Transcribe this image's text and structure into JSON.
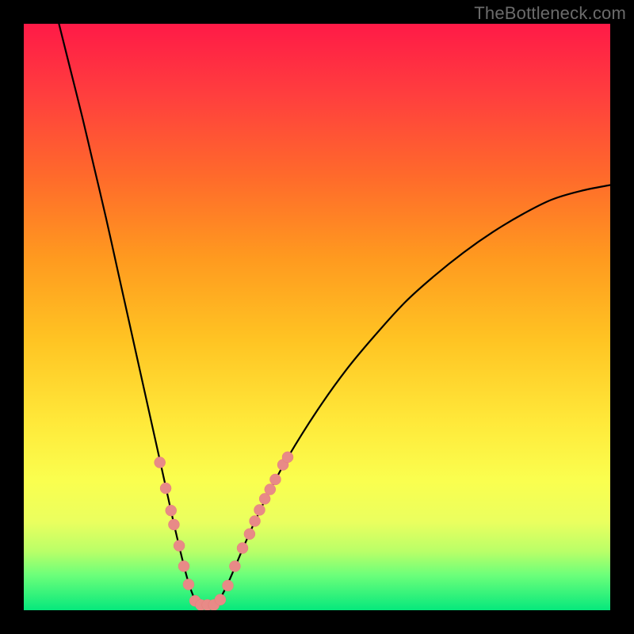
{
  "watermark": "TheBottleneck.com",
  "colors": {
    "frame": "#000000",
    "bead": "#e88a87",
    "curve": "#000000",
    "gradient_top": "#ff1a47",
    "gradient_bottom": "#06e87c"
  },
  "chart_data": {
    "type": "line",
    "title": "",
    "xlabel": "",
    "ylabel": "",
    "xlim": [
      0,
      100
    ],
    "ylim": [
      0,
      100
    ],
    "grid": false,
    "legend": false,
    "curve_left": {
      "description": "Steep descending branch entering from top-left, reaching valley floor near x≈29",
      "points": [
        {
          "x": 6.0,
          "y": 100.0
        },
        {
          "x": 8.0,
          "y": 92.0
        },
        {
          "x": 10.0,
          "y": 84.0
        },
        {
          "x": 12.0,
          "y": 75.5
        },
        {
          "x": 14.0,
          "y": 67.0
        },
        {
          "x": 16.0,
          "y": 58.0
        },
        {
          "x": 18.0,
          "y": 49.0
        },
        {
          "x": 20.0,
          "y": 40.0
        },
        {
          "x": 22.0,
          "y": 31.0
        },
        {
          "x": 24.0,
          "y": 22.0
        },
        {
          "x": 26.0,
          "y": 13.0
        },
        {
          "x": 28.0,
          "y": 5.0
        },
        {
          "x": 29.5,
          "y": 1.0
        }
      ]
    },
    "curve_right": {
      "description": "Ascending branch rising from valley, concave, exiting at right edge near y≈72",
      "points": [
        {
          "x": 33.0,
          "y": 1.0
        },
        {
          "x": 35.0,
          "y": 5.0
        },
        {
          "x": 38.0,
          "y": 12.0
        },
        {
          "x": 41.0,
          "y": 18.5
        },
        {
          "x": 45.0,
          "y": 26.0
        },
        {
          "x": 50.0,
          "y": 34.0
        },
        {
          "x": 55.0,
          "y": 41.0
        },
        {
          "x": 60.0,
          "y": 47.0
        },
        {
          "x": 65.0,
          "y": 52.5
        },
        {
          "x": 70.0,
          "y": 57.0
        },
        {
          "x": 75.0,
          "y": 61.0
        },
        {
          "x": 80.0,
          "y": 64.5
        },
        {
          "x": 85.0,
          "y": 67.5
        },
        {
          "x": 90.0,
          "y": 70.0
        },
        {
          "x": 95.0,
          "y": 71.5
        },
        {
          "x": 100.0,
          "y": 72.5
        }
      ]
    },
    "valley_floor": {
      "description": "Flat valley bottom segment",
      "points": [
        {
          "x": 29.5,
          "y": 1.0
        },
        {
          "x": 33.0,
          "y": 1.0
        }
      ]
    },
    "beads": {
      "description": "Salmon-colored marker dots clustered in the valley region along the curve",
      "r": 7.0,
      "points": [
        {
          "x": 23.2,
          "y": 25.2
        },
        {
          "x": 24.2,
          "y": 20.8
        },
        {
          "x": 25.1,
          "y": 17.0
        },
        {
          "x": 25.6,
          "y": 14.6
        },
        {
          "x": 26.5,
          "y": 11.0
        },
        {
          "x": 27.3,
          "y": 7.5
        },
        {
          "x": 28.1,
          "y": 4.4
        },
        {
          "x": 29.2,
          "y": 1.6
        },
        {
          "x": 30.2,
          "y": 0.9
        },
        {
          "x": 31.3,
          "y": 0.9
        },
        {
          "x": 32.4,
          "y": 0.9
        },
        {
          "x": 33.5,
          "y": 1.8
        },
        {
          "x": 34.8,
          "y": 4.2
        },
        {
          "x": 36.0,
          "y": 7.5
        },
        {
          "x": 37.3,
          "y": 10.6
        },
        {
          "x": 38.5,
          "y": 13.0
        },
        {
          "x": 39.4,
          "y": 15.2
        },
        {
          "x": 40.2,
          "y": 17.1
        },
        {
          "x": 41.1,
          "y": 19.0
        },
        {
          "x": 42.0,
          "y": 20.6
        },
        {
          "x": 42.9,
          "y": 22.3
        },
        {
          "x": 44.2,
          "y": 24.8
        },
        {
          "x": 45.0,
          "y": 26.1
        }
      ]
    }
  }
}
